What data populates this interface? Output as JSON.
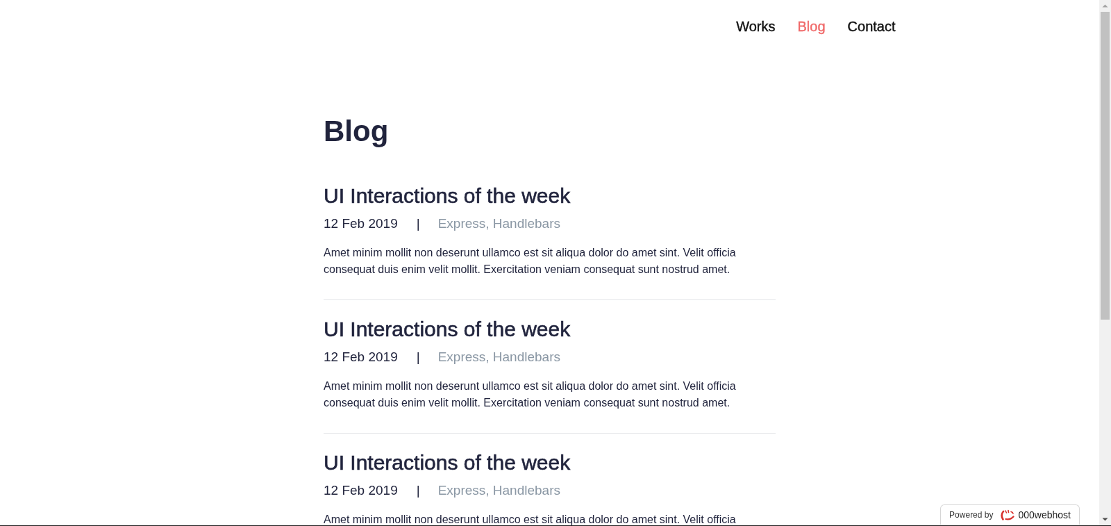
{
  "nav": {
    "items": [
      {
        "label": "Works",
        "selected": false
      },
      {
        "label": "Blog",
        "selected": true
      },
      {
        "label": "Contact",
        "selected": false
      }
    ]
  },
  "page": {
    "title": "Blog"
  },
  "posts": [
    {
      "title": "UI Interactions of the week",
      "date": "12 Feb 2019",
      "separator": "|",
      "tags": "Express, Handlebars",
      "excerpt": "Amet minim mollit non deserunt ullamco est sit aliqua dolor do amet sint. Velit officia consequat duis enim velit mollit. Exercitation veniam consequat sunt nostrud amet."
    },
    {
      "title": "UI Interactions of the week",
      "date": "12 Feb 2019",
      "separator": "|",
      "tags": "Express, Handlebars",
      "excerpt": "Amet minim mollit non deserunt ullamco est sit aliqua dolor do amet sint. Velit officia consequat duis enim velit mollit. Exercitation veniam consequat sunt nostrud amet."
    },
    {
      "title": "UI Interactions of the week",
      "date": "12 Feb 2019",
      "separator": "|",
      "tags": "Express, Handlebars",
      "excerpt": "Amet minim mollit non deserunt ullamco est sit aliqua dolor do amet sint. Velit officia"
    }
  ],
  "badge": {
    "prefix": "Powered by",
    "brand": "000webhost"
  }
}
